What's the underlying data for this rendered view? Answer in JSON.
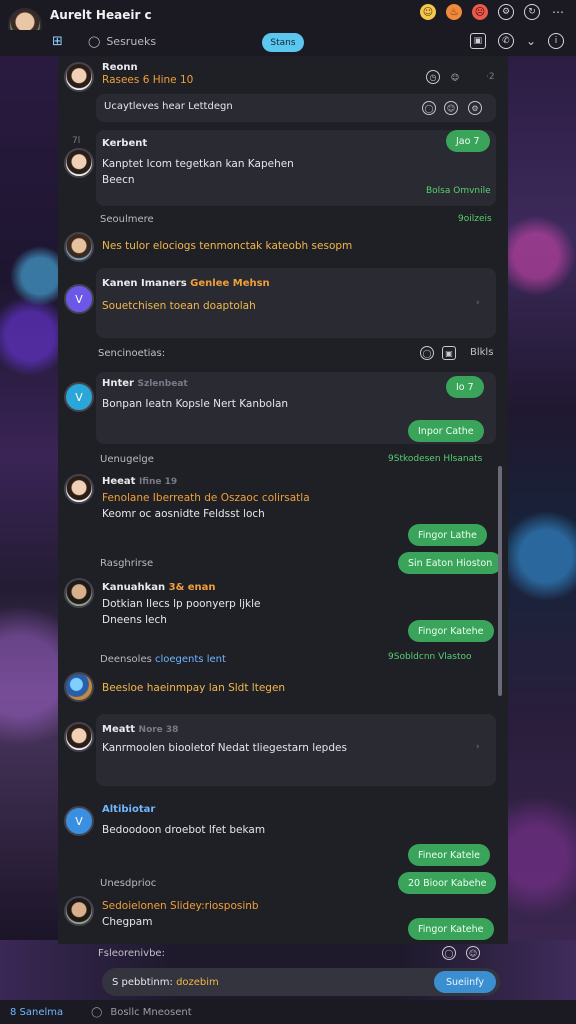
{
  "app": {
    "title": "Aurelt Heaeir c"
  },
  "toolbar": {
    "search_label": "Sesrueks",
    "pill_label": "Stans"
  },
  "messages": [
    {
      "name": "Reonn",
      "meta": "Rasees 6 Hine 10",
      "color": ""
    },
    {
      "divider": "Ucaytleves hear Lettdegn"
    },
    {
      "name": "Kerbent",
      "text1": "Kanptet Icom tegetkan kan Kapehen",
      "text2": "Beecn",
      "pill": "Jao 7",
      "sub": "Bolsa Omvnile",
      "time": "7l"
    },
    {
      "name": "Seoulmere",
      "text1": "Nes tulor elociogs tenmonctak kateobh sesopm",
      "time": "9oilzeis"
    },
    {
      "name": "Kanen Imaners",
      "name_tag": "Genlee Mehsn",
      "text1": "Souetchisen toean doaptolah"
    },
    {
      "divider": "Sencinoetias:",
      "right": "Blkls"
    },
    {
      "name": "Hnter",
      "tag": "Szlenbeat",
      "text1": "Bonpan Ieatn Kopsle Nert Kanbolan",
      "pill": "Io 7",
      "pill2": "Inpor Cathe"
    },
    {
      "name": "Uenugelge",
      "gtag": "9Stkodesen Hlsanats",
      "name2": "Heeat",
      "time": "Ifine 19",
      "text1": "Fenolane Iberreath de Oszaoc colirsatla",
      "text2": "Keomr oc aosnidte Feldsst loch",
      "pill": "Fingor Lathe"
    },
    {
      "name": "Rasghrirse",
      "gpill": "Sin Eaton Hioston",
      "name2": "Kanuahkan",
      "tag": "3& enan",
      "text1": "Dotkian Ilecs lp poonyerp ljkle",
      "text2": "Dneens lech",
      "pill": "Fingor Katehe"
    },
    {
      "name": "Deensoles",
      "link": "cloegents lent",
      "gtag": "9Sobldcnn Vlastoo",
      "text1": "Beesloe haeinmpay lan Sldt ltegen"
    },
    {
      "name": "Meatt",
      "tag": "Nore 38",
      "text1": "Kanrmoolen biooletof Nedat tliegestarn lepdes"
    },
    {
      "name": "Altibiotar",
      "text1": "Bedoodoon droebot lfet bekam",
      "pill": "Fineor Katele"
    },
    {
      "name": "Unesdprioc",
      "pill": "20 Bioor Kabehe",
      "text0": "Sedoielonen Slidey:riosposinb",
      "text1": "Chegpam",
      "pill2": "Fingor Katehe"
    },
    {
      "divider": "Fsleorenivbe:"
    }
  ],
  "input": {
    "value": "S pebbtinm:",
    "link": "dozebim",
    "send": "Sueiinfy"
  },
  "bottom": {
    "label": "8 Sanelma",
    "search": "Bosllc Mneosent"
  }
}
